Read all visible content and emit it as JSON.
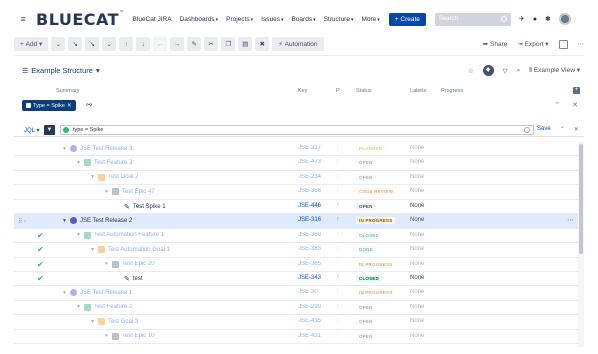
{
  "nav": {
    "logo": "BLUECAT",
    "logo_tm": "™",
    "app": "BlueCat JIRA",
    "items": [
      "Dashboards",
      "Projects",
      "Issues",
      "Boards",
      "Structure",
      "More"
    ],
    "create": "+ Create",
    "search_placeholder": "Search"
  },
  "toolbar": {
    "add": "Add",
    "automation": "Automation",
    "share": "Share",
    "export": "Export"
  },
  "structure": {
    "title": "Example Structure",
    "view": "Example View"
  },
  "columns": {
    "summary": "Summary",
    "key": "Key",
    "p": "P",
    "status": "Status",
    "labels": "Labels",
    "progress": "Progress"
  },
  "filter": {
    "chip": "Type = Spike",
    "jql_label": "JQL",
    "jql_value": "type = Spike",
    "save": "Save"
  },
  "colors": {
    "release": "#6554c0",
    "feature": "#36b37e",
    "goal": "#ff991f",
    "epic": "#6b778c",
    "link": "#0052cc"
  },
  "rows": [
    {
      "summary": "JSE Test Release 3",
      "key": "JSE-317",
      "status": "PLANNED",
      "status_class": "st-planned",
      "labels": "None",
      "type": "release",
      "indent": 0,
      "dim": true,
      "sel": false,
      "check": false
    },
    {
      "summary": "Test Feature 3",
      "key": "JSE-473",
      "status": "OPEN",
      "status_class": "st-open",
      "labels": "None",
      "type": "feature",
      "indent": 1,
      "dim": true,
      "sel": false,
      "check": false
    },
    {
      "summary": "Test Goal 2",
      "key": "JSE-234",
      "status": "OPEN",
      "status_class": "st-open",
      "labels": "None",
      "type": "goal",
      "indent": 2,
      "dim": true,
      "sel": false,
      "check": false
    },
    {
      "summary": "Test Epic 47",
      "key": "JSE-366",
      "status": "CODE REVIEW",
      "status_class": "st-review",
      "labels": "None",
      "type": "epic",
      "indent": 3,
      "dim": true,
      "sel": false,
      "check": false
    },
    {
      "summary": "Test Spike 1",
      "key": "JSE-446",
      "status": "OPEN",
      "status_class": "st-open",
      "labels": "None",
      "type": "spike",
      "indent": 4,
      "dim": false,
      "sel": false,
      "check": false
    },
    {
      "summary": "JSE Test Release 2",
      "key": "JSE-316",
      "status": "IN PROGRESS",
      "status_class": "st-progress",
      "labels": "None",
      "type": "release",
      "indent": 0,
      "dim": false,
      "sel": true,
      "check": false
    },
    {
      "summary": "Test Automation Feature 1",
      "key": "JSE-360",
      "status": "CLOSED",
      "status_class": "st-closed",
      "labels": "None",
      "type": "feature",
      "indent": 1,
      "dim": true,
      "sel": false,
      "check": true
    },
    {
      "summary": "Test Automation Goal 1",
      "key": "JSE-383",
      "status": "DONE",
      "status_class": "st-done",
      "labels": "None",
      "type": "goal",
      "indent": 2,
      "dim": true,
      "sel": false,
      "check": true
    },
    {
      "summary": "Test Epic 20",
      "key": "JSE-365",
      "status": "IN PROGRESS",
      "status_class": "st-progress",
      "labels": "None",
      "type": "epic",
      "indent": 3,
      "dim": true,
      "sel": false,
      "check": true
    },
    {
      "summary": "test",
      "key": "JSE-343",
      "status": "CLOSED",
      "status_class": "st-closed",
      "labels": "None",
      "type": "spike",
      "indent": 4,
      "dim": false,
      "sel": false,
      "check": true
    },
    {
      "summary": "JSE Test Release 1",
      "key": "JSE-30",
      "status": "IN PROGRESS",
      "status_class": "st-progress",
      "labels": "None",
      "type": "release",
      "indent": 0,
      "dim": true,
      "sel": false,
      "check": false
    },
    {
      "summary": "Test Feature 2",
      "key": "JSE-290",
      "status": "OPEN",
      "status_class": "st-open",
      "labels": "None",
      "type": "feature",
      "indent": 1,
      "dim": true,
      "sel": false,
      "check": false
    },
    {
      "summary": "Test Goal 3",
      "key": "JSE-435",
      "status": "OPEN",
      "status_class": "st-open",
      "labels": "None",
      "type": "goal",
      "indent": 2,
      "dim": true,
      "sel": false,
      "check": false
    },
    {
      "summary": "Test Epic 10",
      "key": "JSE-431",
      "status": "OPEN",
      "status_class": "st-open",
      "labels": "None",
      "type": "epic",
      "indent": 3,
      "dim": true,
      "sel": false,
      "check": false
    }
  ]
}
